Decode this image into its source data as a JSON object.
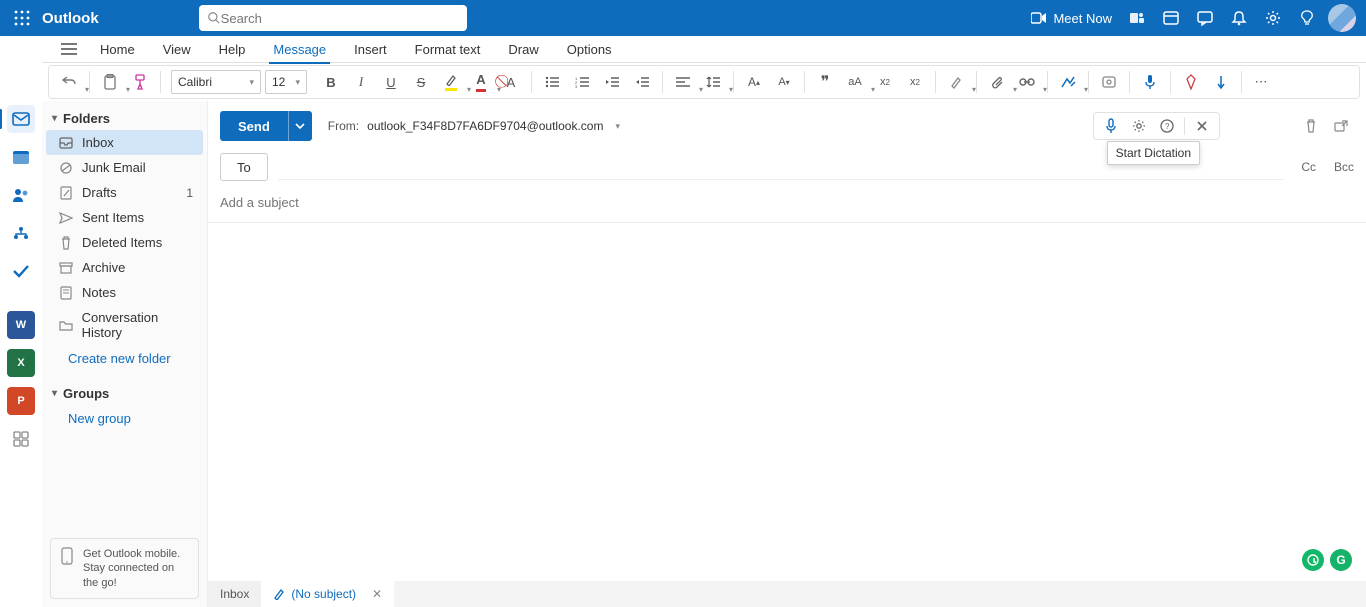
{
  "app": {
    "name": "Outlook"
  },
  "search": {
    "placeholder": "Search"
  },
  "header": {
    "meet_now": "Meet Now"
  },
  "menu": {
    "home": "Home",
    "view": "View",
    "help": "Help",
    "message": "Message",
    "insert": "Insert",
    "format_text": "Format text",
    "draw": "Draw",
    "options": "Options"
  },
  "toolbar": {
    "font": "Calibri",
    "size": "12"
  },
  "sidebar": {
    "folders_label": "Folders",
    "items": [
      {
        "label": "Inbox",
        "badge": ""
      },
      {
        "label": "Junk Email",
        "badge": ""
      },
      {
        "label": "Drafts",
        "badge": "1"
      },
      {
        "label": "Sent Items",
        "badge": ""
      },
      {
        "label": "Deleted Items",
        "badge": ""
      },
      {
        "label": "Archive",
        "badge": ""
      },
      {
        "label": "Notes",
        "badge": ""
      },
      {
        "label": "Conversation History",
        "badge": ""
      }
    ],
    "create_folder": "Create new folder",
    "groups_label": "Groups",
    "new_group": "New group",
    "promo_line1": "Get Outlook mobile.",
    "promo_line2": "Stay connected on the go!"
  },
  "compose": {
    "send": "Send",
    "from_label": "From:",
    "from_addr": "outlook_F34F8D7FA6DF9704@outlook.com",
    "to_label": "To",
    "cc": "Cc",
    "bcc": "Bcc",
    "subject_placeholder": "Add a subject",
    "tooltip_dictation": "Start Dictation"
  },
  "tabs": {
    "inbox": "Inbox",
    "draft": "(No subject)"
  }
}
